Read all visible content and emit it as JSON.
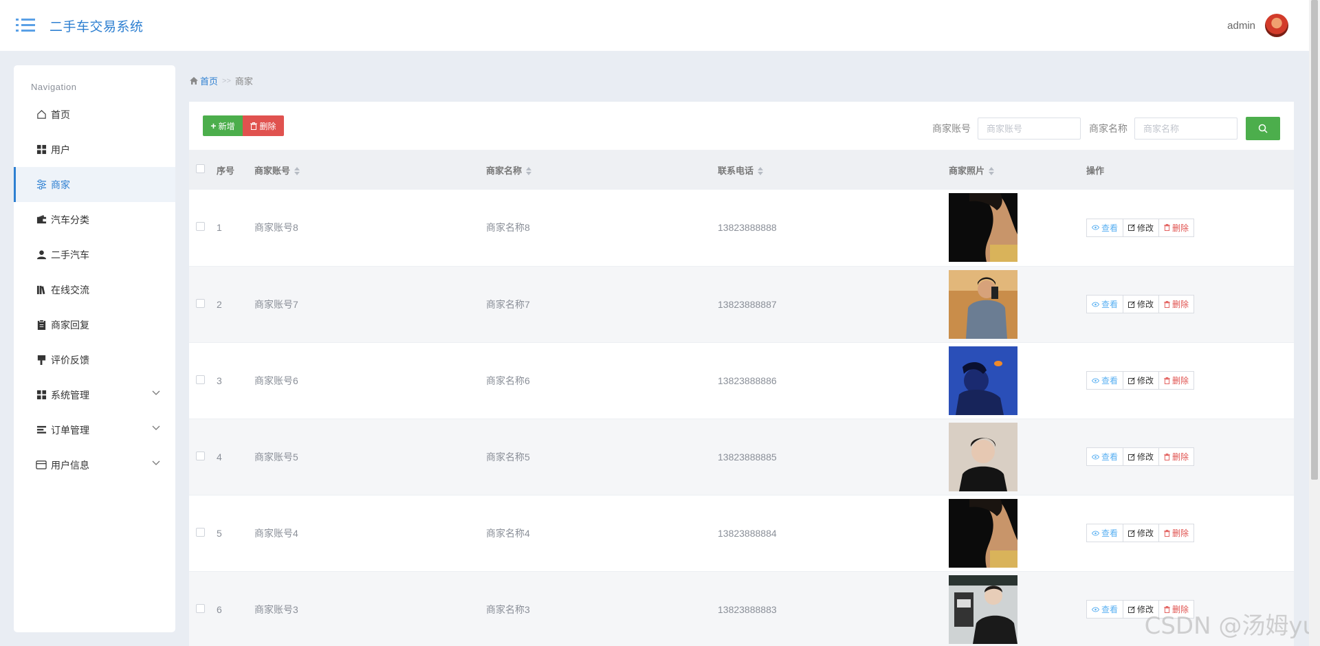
{
  "header": {
    "app_title": "二手车交易系统",
    "username": "admin"
  },
  "sidebar": {
    "nav_title": "Navigation",
    "items": [
      {
        "label": "首页",
        "icon": "home-icon",
        "active": false,
        "expandable": false
      },
      {
        "label": "用户",
        "icon": "grid-icon",
        "active": false,
        "expandable": false
      },
      {
        "label": "商家",
        "icon": "sliders-icon",
        "active": true,
        "expandable": false
      },
      {
        "label": "汽车分类",
        "icon": "wallet-icon",
        "active": false,
        "expandable": false
      },
      {
        "label": "二手汽车",
        "icon": "user-icon",
        "active": false,
        "expandable": false
      },
      {
        "label": "在线交流",
        "icon": "books-icon",
        "active": false,
        "expandable": false
      },
      {
        "label": "商家回复",
        "icon": "clipboard-icon",
        "active": false,
        "expandable": false
      },
      {
        "label": "评价反馈",
        "icon": "brush-icon",
        "active": false,
        "expandable": false
      },
      {
        "label": "系统管理",
        "icon": "grid-icon",
        "active": false,
        "expandable": true
      },
      {
        "label": "订单管理",
        "icon": "list-icon",
        "active": false,
        "expandable": true
      },
      {
        "label": "用户信息",
        "icon": "card-icon",
        "active": false,
        "expandable": true
      }
    ]
  },
  "breadcrumb": {
    "home": "首页",
    "separator": ">>",
    "current": "商家"
  },
  "toolbar": {
    "add_label": "新增",
    "delete_label": "删除",
    "search_account_label": "商家账号",
    "search_account_placeholder": "商家账号",
    "search_name_label": "商家名称",
    "search_name_placeholder": "商家名称"
  },
  "table": {
    "headers": {
      "index": "序号",
      "account": "商家账号",
      "name": "商家名称",
      "phone": "联系电话",
      "photo": "商家照片",
      "actions": "操作"
    },
    "actions": {
      "view": "查看",
      "edit": "修改",
      "remove": "删除"
    },
    "rows": [
      {
        "index": "1",
        "account": "商家账号8",
        "name": "商家名称8",
        "phone": "13823888888",
        "photo": "portrait-dark-profile"
      },
      {
        "index": "2",
        "account": "商家账号7",
        "name": "商家名称7",
        "phone": "13823888887",
        "photo": "portrait-mirror-selfie"
      },
      {
        "index": "3",
        "account": "商家账号6",
        "name": "商家名称6",
        "phone": "13823888886",
        "photo": "portrait-blue-goldfish"
      },
      {
        "index": "4",
        "account": "商家账号5",
        "name": "商家名称5",
        "phone": "13823888885",
        "photo": "portrait-black-turtleneck"
      },
      {
        "index": "5",
        "account": "商家账号4",
        "name": "商家名称4",
        "phone": "13823888884",
        "photo": "portrait-dark-profile"
      },
      {
        "index": "6",
        "account": "商家账号3",
        "name": "商家名称3",
        "phone": "13823888883",
        "photo": "portrait-glasses-phonebooth"
      }
    ]
  },
  "watermark": "CSDN @汤姆yu",
  "colors": {
    "primary": "#2d7fd1",
    "success": "#4cae4c",
    "danger": "#e0524f",
    "info": "#5ab0f2"
  }
}
